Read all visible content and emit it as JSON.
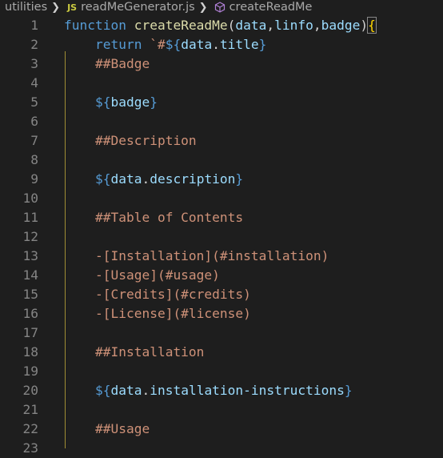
{
  "breadcrumb": {
    "folder": "utilities",
    "js_badge": "JS",
    "file": "readMeGenerator.js",
    "symbol": "createReadMe",
    "separator_icon": "chevron-right-icon",
    "symbol_icon": "cube-function-icon"
  },
  "colors": {
    "background": "#1e1e1e",
    "keyword": "#569cd6",
    "function": "#dcdcaa",
    "variable": "#9cdcfe",
    "string": "#ce9178",
    "bracket": "#ffd700",
    "line_number": "#858585"
  },
  "lines": [
    {
      "n": "1",
      "parts": [
        {
          "t": "function ",
          "c": "kw"
        },
        {
          "t": "createReadMe",
          "c": "fnname"
        },
        {
          "t": "(",
          "c": "punc"
        },
        {
          "t": "data",
          "c": "param"
        },
        {
          "t": ",",
          "c": "punc"
        },
        {
          "t": "linfo",
          "c": "param"
        },
        {
          "t": ",",
          "c": "punc"
        },
        {
          "t": "badge",
          "c": "param"
        },
        {
          "t": ")",
          "c": "punc"
        },
        {
          "t": "{",
          "c": "brace"
        }
      ]
    },
    {
      "n": "2",
      "parts": [
        {
          "t": "    return ",
          "c": "kw"
        },
        {
          "t": "`#",
          "c": "str"
        },
        {
          "t": "${",
          "c": "interp"
        },
        {
          "t": "data",
          "c": "var"
        },
        {
          "t": ".",
          "c": "punc"
        },
        {
          "t": "title",
          "c": "var"
        },
        {
          "t": "}",
          "c": "interp"
        }
      ]
    },
    {
      "n": "3",
      "parts": [
        {
          "t": "    ##Badge",
          "c": "str"
        }
      ]
    },
    {
      "n": "4",
      "parts": []
    },
    {
      "n": "5",
      "parts": [
        {
          "t": "    ",
          "c": "str"
        },
        {
          "t": "${",
          "c": "interp"
        },
        {
          "t": "badge",
          "c": "var"
        },
        {
          "t": "}",
          "c": "interp"
        }
      ]
    },
    {
      "n": "6",
      "parts": []
    },
    {
      "n": "7",
      "parts": [
        {
          "t": "    ##Description",
          "c": "str"
        }
      ]
    },
    {
      "n": "8",
      "parts": []
    },
    {
      "n": "9",
      "parts": [
        {
          "t": "    ",
          "c": "str"
        },
        {
          "t": "${",
          "c": "interp"
        },
        {
          "t": "data",
          "c": "var"
        },
        {
          "t": ".",
          "c": "punc"
        },
        {
          "t": "description",
          "c": "var"
        },
        {
          "t": "}",
          "c": "interp"
        }
      ]
    },
    {
      "n": "10",
      "parts": []
    },
    {
      "n": "11",
      "parts": [
        {
          "t": "    ##Table of Contents",
          "c": "str"
        }
      ]
    },
    {
      "n": "12",
      "parts": []
    },
    {
      "n": "13",
      "parts": [
        {
          "t": "    -[Installation](#installation)",
          "c": "str"
        }
      ]
    },
    {
      "n": "14",
      "parts": [
        {
          "t": "    -[Usage](#usage)",
          "c": "str"
        }
      ]
    },
    {
      "n": "15",
      "parts": [
        {
          "t": "    -[Credits](#credits)",
          "c": "str"
        }
      ]
    },
    {
      "n": "16",
      "parts": [
        {
          "t": "    -[License](#license)",
          "c": "str"
        }
      ]
    },
    {
      "n": "17",
      "parts": []
    },
    {
      "n": "18",
      "parts": [
        {
          "t": "    ##Installation",
          "c": "str"
        }
      ]
    },
    {
      "n": "19",
      "parts": []
    },
    {
      "n": "20",
      "parts": [
        {
          "t": "    ",
          "c": "str"
        },
        {
          "t": "${",
          "c": "interp"
        },
        {
          "t": "data",
          "c": "var"
        },
        {
          "t": ".",
          "c": "punc"
        },
        {
          "t": "installation-instructions",
          "c": "var"
        },
        {
          "t": "}",
          "c": "interp"
        }
      ]
    },
    {
      "n": "21",
      "parts": []
    },
    {
      "n": "22",
      "parts": [
        {
          "t": "    ##Usage",
          "c": "str"
        }
      ]
    },
    {
      "n": "23",
      "parts": []
    }
  ]
}
